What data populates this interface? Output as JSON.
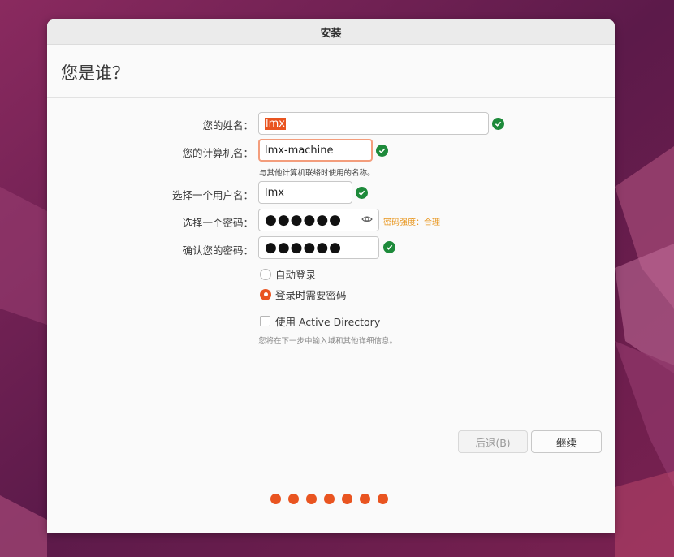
{
  "window": {
    "title": "安装"
  },
  "page": {
    "title": "您是谁？"
  },
  "form": {
    "name": {
      "label": "您的姓名：",
      "value": "lmx",
      "valid": true
    },
    "computer": {
      "label": "您的计算机名：",
      "value": "lmx-machine",
      "hint": "与其他计算机联络时使用的名称。",
      "valid": true
    },
    "username": {
      "label": "选择一个用户名：",
      "value": "lmx",
      "valid": true
    },
    "password": {
      "label": "选择一个密码：",
      "masked": "●●●●●●",
      "strength": "密码强度：合理"
    },
    "confirm": {
      "label": "确认您的密码：",
      "masked": "●●●●●●",
      "valid": true
    }
  },
  "login": {
    "auto": {
      "label": "自动登录",
      "selected": false
    },
    "require": {
      "label": "登录时需要密码",
      "selected": true
    }
  },
  "active_directory": {
    "label": "使用 Active Directory",
    "checked": false,
    "hint": "您将在下一步中输入域和其他详细信息。"
  },
  "buttons": {
    "back": "后退(B)",
    "continue": "继续"
  },
  "progress": {
    "steps": 7
  },
  "colors": {
    "accent": "#e95420",
    "valid": "#1d8a3a",
    "warning": "#e8951c"
  },
  "icons": {
    "valid": "check-circle-icon",
    "reveal": "eye-icon"
  }
}
